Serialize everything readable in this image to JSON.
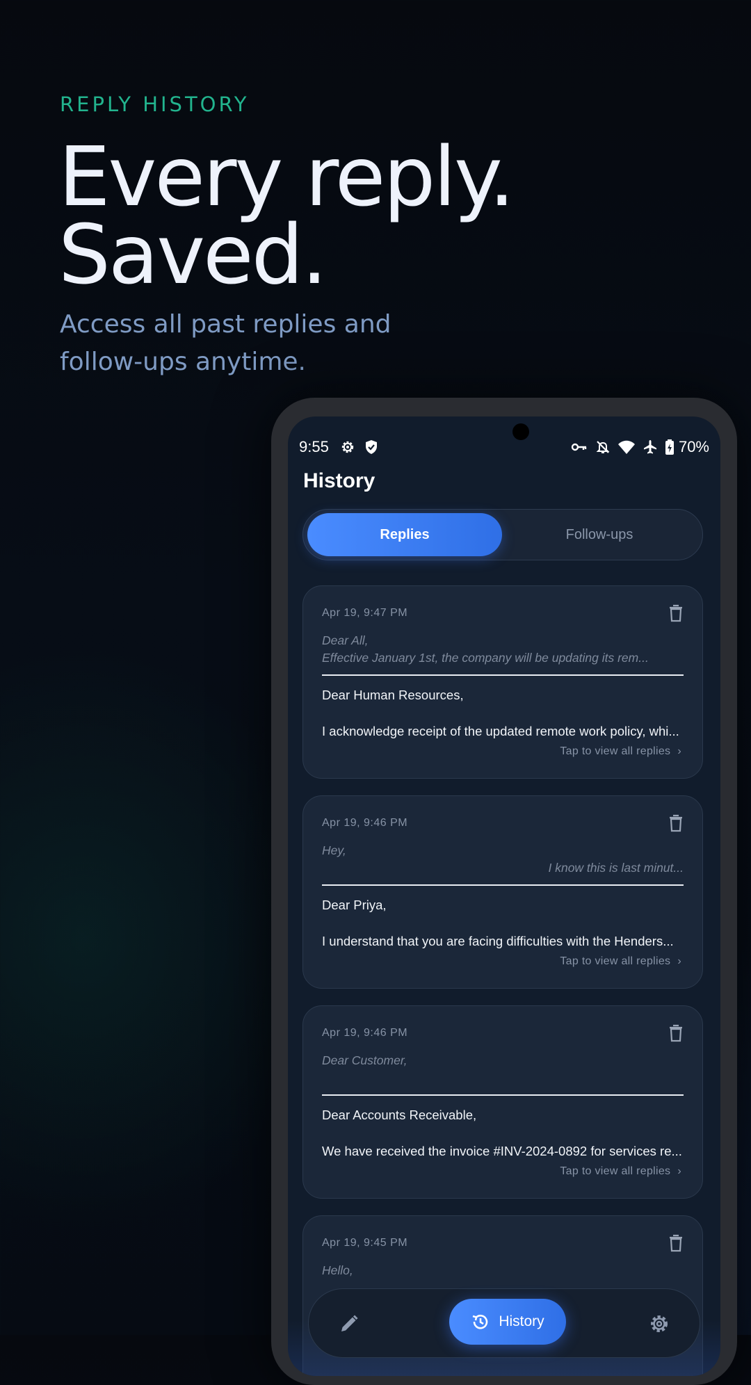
{
  "hero": {
    "eyebrow": "REPLY HISTORY",
    "headline_line1": "Every reply.",
    "headline_line2": "Saved.",
    "subtitle": "Access all past replies and follow-ups anytime."
  },
  "status_bar": {
    "time": "9:55",
    "battery": "70%",
    "left_icons": [
      "settings-gear-icon",
      "shield-check-icon"
    ],
    "right_icons": [
      "vpn-key-icon",
      "bell-off-icon",
      "wifi-icon",
      "airplane-icon",
      "battery-charging-icon"
    ]
  },
  "screen": {
    "title": "History",
    "tabs": [
      {
        "label": "Replies",
        "active": true
      },
      {
        "label": "Follow-ups",
        "active": false
      }
    ]
  },
  "cards": [
    {
      "date": "Apr 19, 9:47 PM",
      "original_line1": "Dear All,",
      "original_line2": "Effective January 1st, the company will be updating its rem...",
      "greeting": "Dear Human Resources,",
      "body": "I acknowledge receipt of the updated remote work policy, whi...",
      "tap": "Tap to view all replies"
    },
    {
      "date": "Apr 19, 9:46 PM",
      "original_line1": "Hey,",
      "original_line2": "I know this is last minut...",
      "greeting": "Dear Priya,",
      "body": "I understand that you are facing difficulties with the Henders...",
      "tap": "Tap to view all replies"
    },
    {
      "date": "Apr 19, 9:46 PM",
      "original_line1": "Dear Customer,",
      "original_line2": "",
      "greeting": "Dear Accounts Receivable,",
      "body": "We have received the invoice #INV-2024-0892 for services re...",
      "tap": "Tap to view all replies"
    },
    {
      "date": "Apr 19, 9:45 PM",
      "original_line1": "Hello,",
      "original_line2": "",
      "greeting": "",
      "body": "",
      "tap": ""
    }
  ],
  "bottom_nav": {
    "items": [
      {
        "icon": "pencil-icon",
        "label": ""
      },
      {
        "icon": "history-icon",
        "label": "History",
        "active": true
      },
      {
        "icon": "settings-icon",
        "label": ""
      }
    ]
  },
  "colors": {
    "accent_teal": "#22b48e",
    "accent_blue": "#3f7ff5",
    "screen_bg": "#111c2c",
    "card_bg": "#1b2739"
  }
}
